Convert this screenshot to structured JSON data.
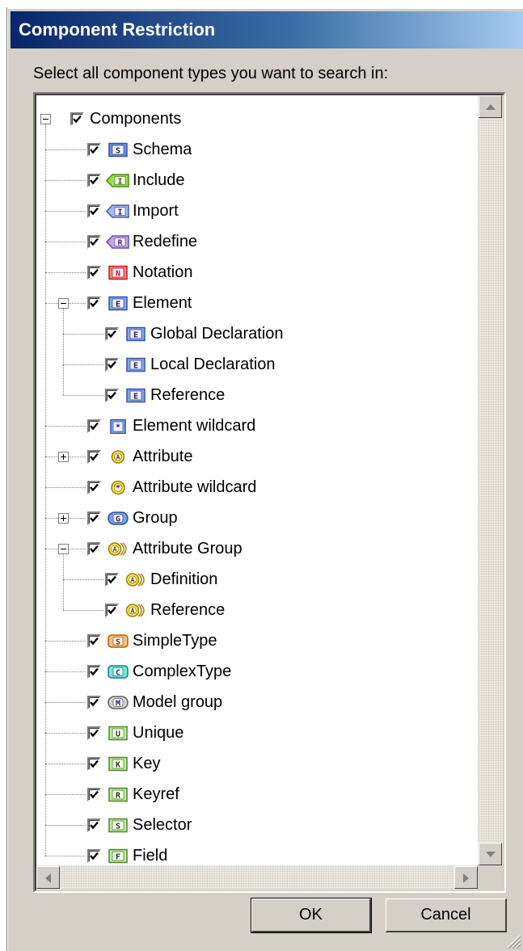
{
  "dialog": {
    "title": "Component Restriction",
    "prompt": "Select all component types you want to search in:"
  },
  "buttons": {
    "ok": "OK",
    "cancel": "Cancel"
  },
  "tree": [
    {
      "label": "Components",
      "level": 0,
      "checked": true,
      "expander": "minus",
      "icon": "none"
    },
    {
      "label": "Schema",
      "level": 1,
      "checked": true,
      "icon": "schema-icon",
      "glyph": "S"
    },
    {
      "label": "Include",
      "level": 1,
      "checked": true,
      "icon": "include-icon",
      "glyph": "I"
    },
    {
      "label": "Import",
      "level": 1,
      "checked": true,
      "icon": "import-icon",
      "glyph": "I"
    },
    {
      "label": "Redefine",
      "level": 1,
      "checked": true,
      "icon": "redefine-icon",
      "glyph": "R"
    },
    {
      "label": "Notation",
      "level": 1,
      "checked": true,
      "icon": "notation-icon",
      "glyph": "N"
    },
    {
      "label": "Element",
      "level": 1,
      "checked": true,
      "expander": "minus",
      "icon": "element-icon",
      "glyph": "E"
    },
    {
      "label": "Global Declaration",
      "level": 2,
      "checked": true,
      "icon": "element-icon",
      "glyph": "E"
    },
    {
      "label": "Local Declaration",
      "level": 2,
      "checked": true,
      "icon": "element-icon",
      "glyph": "E"
    },
    {
      "label": "Reference",
      "level": 2,
      "checked": true,
      "icon": "element-icon",
      "glyph": "E"
    },
    {
      "label": "Element wildcard",
      "level": 1,
      "checked": true,
      "icon": "element-wildcard-icon",
      "glyph": "*"
    },
    {
      "label": "Attribute",
      "level": 1,
      "checked": true,
      "expander": "plus",
      "icon": "attribute-icon",
      "glyph": "A"
    },
    {
      "label": "Attribute wildcard",
      "level": 1,
      "checked": true,
      "icon": "attribute-wildcard-icon",
      "glyph": "*"
    },
    {
      "label": "Group",
      "level": 1,
      "checked": true,
      "expander": "plus",
      "icon": "group-icon",
      "glyph": "G"
    },
    {
      "label": "Attribute Group",
      "level": 1,
      "checked": true,
      "expander": "minus",
      "icon": "attribute-group-icon",
      "glyph": "A"
    },
    {
      "label": "Definition",
      "level": 2,
      "checked": true,
      "icon": "attribute-group-icon",
      "glyph": "A"
    },
    {
      "label": "Reference",
      "level": 2,
      "checked": true,
      "icon": "attribute-group-icon",
      "glyph": "A"
    },
    {
      "label": "SimpleType",
      "level": 1,
      "checked": true,
      "icon": "simple-type-icon",
      "glyph": "S"
    },
    {
      "label": "ComplexType",
      "level": 1,
      "checked": true,
      "icon": "complex-type-icon",
      "glyph": "C"
    },
    {
      "label": "Model group",
      "level": 1,
      "checked": true,
      "icon": "model-group-icon",
      "glyph": "M"
    },
    {
      "label": "Unique",
      "level": 1,
      "checked": true,
      "icon": "unique-icon",
      "glyph": "U"
    },
    {
      "label": "Key",
      "level": 1,
      "checked": true,
      "icon": "key-icon",
      "glyph": "K"
    },
    {
      "label": "Keyref",
      "level": 1,
      "checked": true,
      "icon": "keyref-icon",
      "glyph": "R"
    },
    {
      "label": "Selector",
      "level": 1,
      "checked": true,
      "icon": "selector-icon",
      "glyph": "S"
    },
    {
      "label": "Field",
      "level": 1,
      "checked": true,
      "icon": "field-icon",
      "glyph": "F"
    }
  ],
  "colors": {
    "title_start": "#0a246a",
    "title_end": "#a6caf0",
    "face": "#d4d0c8"
  }
}
